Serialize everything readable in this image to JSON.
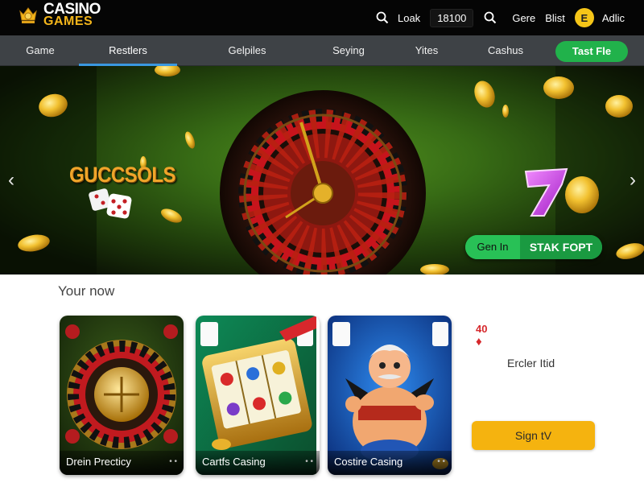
{
  "brand": {
    "line1": "CASINO",
    "line2": "GAMES"
  },
  "header": {
    "search_label": "Loak",
    "balance": "18100",
    "link1": "Gere",
    "link2": "Blist",
    "coin_symbol": "E",
    "account_label": "Adlic"
  },
  "nav": {
    "items": [
      "Game",
      "Restlers",
      "Gelpiles",
      "Seying",
      "Yites",
      "Cashus"
    ],
    "active_index": 1,
    "cta_label": "Tast Fle"
  },
  "hero": {
    "brand_text": "GUCCSOLS",
    "cta_left": "Gen In",
    "cta_right": "STAK FOPT",
    "arrow_prev": "‹",
    "arrow_next": "›"
  },
  "section": {
    "title": "Your now",
    "cards": [
      {
        "label": "Drein Precticy",
        "dots": "• •"
      },
      {
        "label": "Cartfs Casing",
        "dots": "• •"
      },
      {
        "label": "Costire Casing",
        "dots": "• •"
      }
    ]
  },
  "promo": {
    "value": "40",
    "suit": "♦",
    "text": "Ercler Itid",
    "button_label": "Sign tV"
  },
  "colors": {
    "header_bg": "#050505",
    "nav_bg": "#3e4246",
    "active_underline": "#3a98e0",
    "green_cta": "#21b24b",
    "gold": "#f3b51b",
    "signup_button": "#f5b30f"
  },
  "icons": [
    "crown-icon",
    "search-icon",
    "coin-icon",
    "chevron-left-icon",
    "chevron-right-icon"
  ]
}
